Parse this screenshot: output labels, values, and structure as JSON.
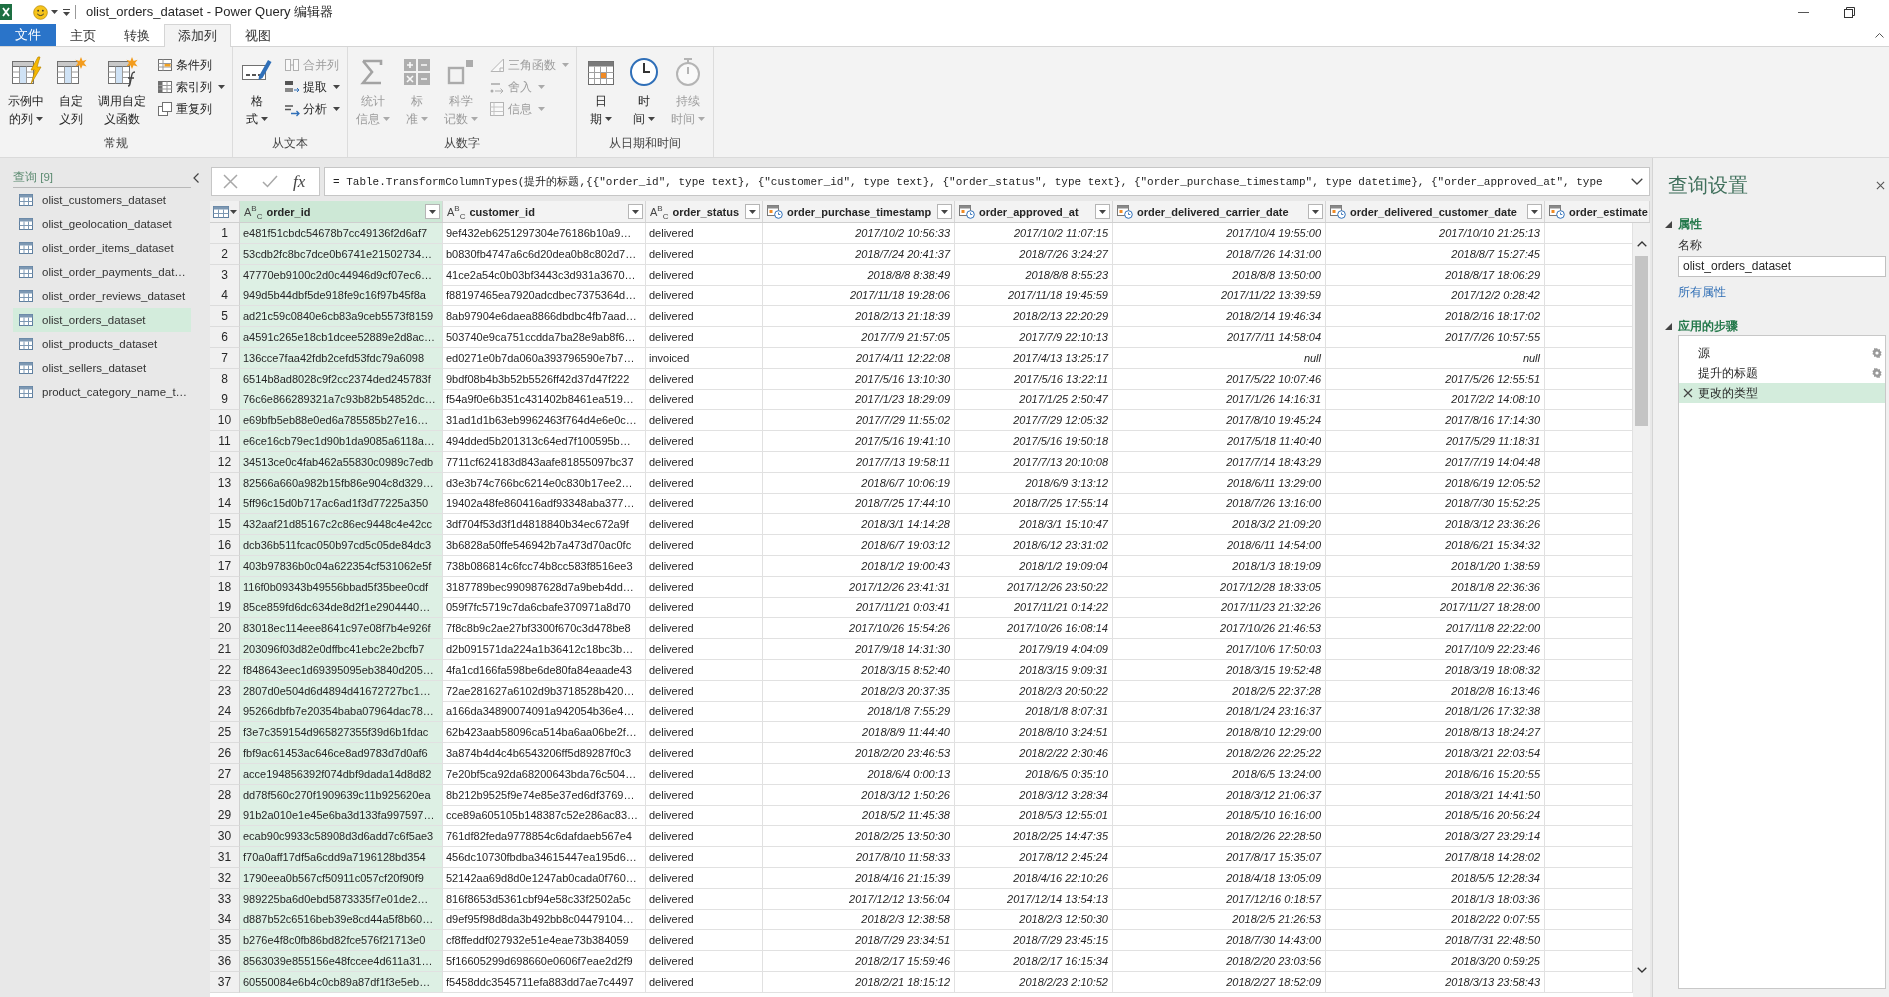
{
  "window": {
    "title": "olist_orders_dataset - Power Query 编辑器"
  },
  "menu_tabs": [
    {
      "label": "文件",
      "kind": "file",
      "selected": false
    },
    {
      "label": "主页",
      "kind": "tab",
      "selected": false
    },
    {
      "label": "转换",
      "kind": "tab",
      "selected": false
    },
    {
      "label": "添加列",
      "kind": "tab",
      "selected": true
    },
    {
      "label": "视图",
      "kind": "tab",
      "selected": false
    }
  ],
  "ribbon": {
    "groups": [
      {
        "label": "常规",
        "items": [
          {
            "kind": "large",
            "lines": [
              "示例中",
              "的列"
            ],
            "dropdown": true,
            "disabled": false
          },
          {
            "kind": "large",
            "lines": [
              "自定",
              "义列"
            ],
            "dropdown": false,
            "disabled": false
          },
          {
            "kind": "large",
            "lines": [
              "调用自定",
              "义函数"
            ],
            "dropdown": false,
            "disabled": false
          },
          {
            "kind": "small",
            "label": "条件列",
            "dropdown": false,
            "disabled": false
          },
          {
            "kind": "small",
            "label": "索引列",
            "dropdown": true,
            "disabled": false
          },
          {
            "kind": "small",
            "label": "重复列",
            "dropdown": false,
            "disabled": false
          }
        ]
      },
      {
        "label": "从文本",
        "items": [
          {
            "kind": "large",
            "lines": [
              "格",
              "式"
            ],
            "dropdown": true,
            "disabled": false
          },
          {
            "kind": "small",
            "label": "合并列",
            "dropdown": false,
            "disabled": true
          },
          {
            "kind": "small",
            "label": "提取",
            "dropdown": true,
            "disabled": false
          },
          {
            "kind": "small",
            "label": "分析",
            "dropdown": true,
            "disabled": false
          }
        ]
      },
      {
        "label": "从数字",
        "items": [
          {
            "kind": "large",
            "lines": [
              "统计",
              "信息"
            ],
            "dropdown": true,
            "disabled": true
          },
          {
            "kind": "large",
            "lines": [
              "标",
              "准"
            ],
            "dropdown": true,
            "disabled": true
          },
          {
            "kind": "large",
            "lines": [
              "科学",
              "记数"
            ],
            "dropdown": true,
            "disabled": true
          },
          {
            "kind": "small",
            "label": "三角函数",
            "dropdown": true,
            "disabled": true
          },
          {
            "kind": "small",
            "label": "舍入",
            "dropdown": true,
            "disabled": true
          },
          {
            "kind": "small",
            "label": "信息",
            "dropdown": true,
            "disabled": true
          }
        ]
      },
      {
        "label": "从日期和时间",
        "items": [
          {
            "kind": "large",
            "lines": [
              "日",
              "期"
            ],
            "dropdown": true,
            "disabled": false
          },
          {
            "kind": "large",
            "lines": [
              "时",
              "间"
            ],
            "dropdown": true,
            "disabled": false
          },
          {
            "kind": "large",
            "lines": [
              "持续",
              "时间"
            ],
            "dropdown": true,
            "disabled": true
          }
        ]
      }
    ]
  },
  "queries": {
    "title": "查询 [9]",
    "items": [
      {
        "label": "olist_customers_dataset",
        "selected": false
      },
      {
        "label": "olist_geolocation_dataset",
        "selected": false
      },
      {
        "label": "olist_order_items_dataset",
        "selected": false
      },
      {
        "label": "olist_order_payments_dat…",
        "selected": false
      },
      {
        "label": "olist_order_reviews_dataset",
        "selected": false
      },
      {
        "label": "olist_orders_dataset",
        "selected": true
      },
      {
        "label": "olist_products_dataset",
        "selected": false
      },
      {
        "label": "olist_sellers_dataset",
        "selected": false
      },
      {
        "label": "product_category_name_t…",
        "selected": false
      }
    ]
  },
  "formula_bar": {
    "function_symbol": "fx",
    "formula": "= Table.TransformColumnTypes(提升的标题,{{\"order_id\", type text}, {\"customer_id\", type text}, {\"order_status\", type text}, {\"order_purchase_timestamp\", type datetime}, {\"order_approved_at\", type"
  },
  "table": {
    "columns": [
      {
        "name": "order_id",
        "kind": "text",
        "type_symbol": "A$^{B}$$_{C}$",
        "selected": true,
        "filter_button": true
      },
      {
        "name": "customer_id",
        "kind": "text",
        "type_symbol": "A$^{B}$$_{C}$",
        "selected": false,
        "filter_button": true
      },
      {
        "name": "order_status",
        "kind": "text",
        "type_symbol": "A$^{B}$$_{C}$",
        "selected": false,
        "filter_button": true
      },
      {
        "name": "order_purchase_timestamp",
        "kind": "datetime",
        "selected": false,
        "filter_button": true
      },
      {
        "name": "order_approved_at",
        "kind": "datetime",
        "selected": false,
        "filter_button": true
      },
      {
        "name": "order_delivered_carrier_date",
        "kind": "datetime",
        "selected": false,
        "filter_button": true
      },
      {
        "name": "order_delivered_customer_date",
        "kind": "datetime",
        "selected": false,
        "filter_button": true
      },
      {
        "name": "order_estimate",
        "kind": "datetime",
        "selected": false,
        "filter_button": false
      }
    ],
    "rows": [
      {
        "number": "1",
        "cells": [
          "e481f51cbdc54678b7cc49136f2d6af7",
          "9ef432eb6251297304e76186b10a9…",
          "delivered",
          "2017/10/2 10:56:33",
          "2017/10/2 11:07:15",
          "2017/10/4 19:55:00",
          "2017/10/10 21:25:13"
        ]
      },
      {
        "number": "2",
        "cells": [
          "53cdb2fc8bc7dce0b6741e21502734…",
          "b0830fb4747a6c6d20dea0b8c802d7…",
          "delivered",
          "2018/7/24 20:41:37",
          "2018/7/26 3:24:27",
          "2018/7/26 14:31:00",
          "2018/8/7 15:27:45"
        ]
      },
      {
        "number": "3",
        "cells": [
          "47770eb9100c2d0c44946d9cf07ec6…",
          "41ce2a54c0b03bf3443c3d931a3670…",
          "delivered",
          "2018/8/8 8:38:49",
          "2018/8/8 8:55:23",
          "2018/8/8 13:50:00",
          "2018/8/17 18:06:29"
        ]
      },
      {
        "number": "4",
        "cells": [
          "949d5b44dbf5de918fe9c16f97b45f8a",
          "f88197465ea7920adcdbec7375364d…",
          "delivered",
          "2017/11/18 19:28:06",
          "2017/11/18 19:45:59",
          "2017/11/22 13:39:59",
          "2017/12/2 0:28:42"
        ]
      },
      {
        "number": "5",
        "cells": [
          "ad21c59c0840e6cb83a9ceb5573f8159",
          "8ab97904e6daea8866dbdbc4fb7aad…",
          "delivered",
          "2018/2/13 21:18:39",
          "2018/2/13 22:20:29",
          "2018/2/14 19:46:34",
          "2018/2/16 18:17:02"
        ]
      },
      {
        "number": "6",
        "cells": [
          "a4591c265e18cb1dcee52889e2d8ac…",
          "503740e9ca751ccdda7ba28e9ab8f6…",
          "delivered",
          "2017/7/9 21:57:05",
          "2017/7/9 22:10:13",
          "2017/7/11 14:58:04",
          "2017/7/26 10:57:55"
        ]
      },
      {
        "number": "7",
        "cells": [
          "136cce7faa42fdb2cefd53fdc79a6098",
          "ed0271e0b7da060a393796590e7b7…",
          "invoiced",
          "2017/4/11 12:22:08",
          "2017/4/13 13:25:17",
          "null",
          "null"
        ]
      },
      {
        "number": "8",
        "cells": [
          "6514b8ad8028c9f2cc2374ded245783f",
          "9bdf08b4b3b52b5526ff42d37d47f222",
          "delivered",
          "2017/5/16 13:10:30",
          "2017/5/16 13:22:11",
          "2017/5/22 10:07:46",
          "2017/5/26 12:55:51"
        ]
      },
      {
        "number": "9",
        "cells": [
          "76c6e866289321a7c93b82b54852dc…",
          "f54a9f0e6b351c431402b8461ea519…",
          "delivered",
          "2017/1/23 18:29:09",
          "2017/1/25 2:50:47",
          "2017/1/26 14:16:31",
          "2017/2/2 14:08:10"
        ]
      },
      {
        "number": "10",
        "cells": [
          "e69bfb5eb88e0ed6a785585b27e16…",
          "31ad1d1b63eb9962463f764d4e6e0c…",
          "delivered",
          "2017/7/29 11:55:02",
          "2017/7/29 12:05:32",
          "2017/8/10 19:45:24",
          "2017/8/16 17:14:30"
        ]
      },
      {
        "number": "11",
        "cells": [
          "e6ce16cb79ec1d90b1da9085a6118a…",
          "494dded5b201313c64ed7f100595b…",
          "delivered",
          "2017/5/16 19:41:10",
          "2017/5/16 19:50:18",
          "2017/5/18 11:40:40",
          "2017/5/29 11:18:31"
        ]
      },
      {
        "number": "12",
        "cells": [
          "34513ce0c4fab462a55830c0989c7edb",
          "7711cf624183d843aafe81855097bc37",
          "delivered",
          "2017/7/13 19:58:11",
          "2017/7/13 20:10:08",
          "2017/7/14 18:43:29",
          "2017/7/19 14:04:48"
        ]
      },
      {
        "number": "13",
        "cells": [
          "82566a660a982b15fb86e904c8d329…",
          "d3e3b74c766bc6214e0c830b17ee2…",
          "delivered",
          "2018/6/7 10:06:19",
          "2018/6/9 3:13:12",
          "2018/6/11 13:29:00",
          "2018/6/19 12:05:52"
        ]
      },
      {
        "number": "14",
        "cells": [
          "5ff96c15d0b717ac6ad1f3d77225a350",
          "19402a48fe860416adf93348aba377…",
          "delivered",
          "2018/7/25 17:44:10",
          "2018/7/25 17:55:14",
          "2018/7/26 13:16:00",
          "2018/7/30 15:52:25"
        ]
      },
      {
        "number": "15",
        "cells": [
          "432aaf21d85167c2c86ec9448c4e42cc",
          "3df704f53d3f1d4818840b34ec672a9f",
          "delivered",
          "2018/3/1 14:14:28",
          "2018/3/1 15:10:47",
          "2018/3/2 21:09:20",
          "2018/3/12 23:36:26"
        ]
      },
      {
        "number": "16",
        "cells": [
          "dcb36b511fcac050b97cd5c05de84dc3",
          "3b6828a50ffe546942b7a473d70ac0fc",
          "delivered",
          "2018/6/7 19:03:12",
          "2018/6/12 23:31:02",
          "2018/6/11 14:54:00",
          "2018/6/21 15:34:32"
        ]
      },
      {
        "number": "17",
        "cells": [
          "403b97836b0c04a622354cf531062e5f",
          "738b086814c6fcc74b8cc583f8516ee3",
          "delivered",
          "2018/1/2 19:00:43",
          "2018/1/2 19:09:04",
          "2018/1/3 18:19:09",
          "2018/1/20 1:38:59"
        ]
      },
      {
        "number": "18",
        "cells": [
          "116f0b09343b49556bbad5f35bee0cdf",
          "3187789bec990987628d7a9beb4dd…",
          "delivered",
          "2017/12/26 23:41:31",
          "2017/12/26 23:50:22",
          "2017/12/28 18:33:05",
          "2018/1/8 22:36:36"
        ]
      },
      {
        "number": "19",
        "cells": [
          "85ce859fd6dc634de8d2f1e2904440…",
          "059f7fc5719c7da6cbafe370971a8d70",
          "delivered",
          "2017/11/21 0:03:41",
          "2017/11/21 0:14:22",
          "2017/11/23 21:32:26",
          "2017/11/27 18:28:00"
        ]
      },
      {
        "number": "20",
        "cells": [
          "83018ec114eee8641c97e08f7b4e926f",
          "7f8c8b9c2ae27bf3300f670c3d478be8",
          "delivered",
          "2017/10/26 15:54:26",
          "2017/10/26 16:08:14",
          "2017/10/26 21:46:53",
          "2017/11/8 22:22:00"
        ]
      },
      {
        "number": "21",
        "cells": [
          "203096f03d82e0dffbc41ebc2e2bcfb7",
          "d2b091571da224a1b36412c18bc3b…",
          "delivered",
          "2017/9/18 14:31:30",
          "2017/9/19 4:04:09",
          "2017/10/6 17:50:03",
          "2017/10/9 22:23:46"
        ]
      },
      {
        "number": "22",
        "cells": [
          "f848643eec1d69395095eb3840d205…",
          "4fa1cd166fa598be6de80fa84eaade43",
          "delivered",
          "2018/3/15 8:52:40",
          "2018/3/15 9:09:31",
          "2018/3/15 19:52:48",
          "2018/3/19 18:08:32"
        ]
      },
      {
        "number": "23",
        "cells": [
          "2807d0e504d6d4894d41672727bc1…",
          "72ae281627a6102d9b3718528b420…",
          "delivered",
          "2018/2/3 20:37:35",
          "2018/2/3 20:50:22",
          "2018/2/5 22:37:28",
          "2018/2/8 16:13:46"
        ]
      },
      {
        "number": "24",
        "cells": [
          "95266dbfb7e20354baba07964dac78…",
          "a166da34890074091a942054b36e4…",
          "delivered",
          "2018/1/8 7:55:29",
          "2018/1/8 8:07:31",
          "2018/1/24 23:16:37",
          "2018/1/26 17:32:38"
        ]
      },
      {
        "number": "25",
        "cells": [
          "f3e7c359154d965827355f39d6b1fdac",
          "62b423aab58096ca514ba6aa06be2f…",
          "delivered",
          "2018/8/9 11:44:40",
          "2018/8/10 3:24:51",
          "2018/8/10 12:29:00",
          "2018/8/13 18:24:27"
        ]
      },
      {
        "number": "26",
        "cells": [
          "fbf9ac61453ac646ce8ad9783d7d0af6",
          "3a874b4d4c4b6543206ff5d89287f0c3",
          "delivered",
          "2018/2/20 23:46:53",
          "2018/2/22 2:30:46",
          "2018/2/26 22:25:22",
          "2018/3/21 22:03:54"
        ]
      },
      {
        "number": "27",
        "cells": [
          "acce194856392f074dbf9dada14d8d82",
          "7e20bf5ca92da68200643bda76c504…",
          "delivered",
          "2018/6/4 0:00:13",
          "2018/6/5 0:35:10",
          "2018/6/5 13:24:00",
          "2018/6/16 15:20:55"
        ]
      },
      {
        "number": "28",
        "cells": [
          "dd78f560c270f1909639c11b925620ea",
          "8b212b9525f9e74e85e37ed6df3769…",
          "delivered",
          "2018/3/12 1:50:26",
          "2018/3/12 3:28:34",
          "2018/3/12 21:06:37",
          "2018/3/21 14:41:50"
        ]
      },
      {
        "number": "29",
        "cells": [
          "91b2a010e1e45e6ba3d133fa997597…",
          "cce89a605105b148387c52e286ac83…",
          "delivered",
          "2018/5/2 11:45:38",
          "2018/5/3 12:55:01",
          "2018/5/10 16:16:00",
          "2018/5/16 20:56:24"
        ]
      },
      {
        "number": "30",
        "cells": [
          "ecab90c9933c58908d3d6add7c6f5ae3",
          "761df82feda9778854c6dafdaeb567e4",
          "delivered",
          "2018/2/25 13:50:30",
          "2018/2/25 14:47:35",
          "2018/2/26 22:28:50",
          "2018/3/27 23:29:14"
        ]
      },
      {
        "number": "31",
        "cells": [
          "f70a0aff17df5a6cdd9a7196128bd354",
          "456dc10730fbdba34615447ea195d6…",
          "delivered",
          "2017/8/10 11:58:33",
          "2017/8/12 2:45:24",
          "2017/8/17 15:35:07",
          "2017/8/18 14:28:02"
        ]
      },
      {
        "number": "32",
        "cells": [
          "1790eea0b567cf50911c057cf20f90f9",
          "52142aa69d8d0e1247ab0cada0f760…",
          "delivered",
          "2018/4/16 21:15:39",
          "2018/4/16 22:10:26",
          "2018/4/18 13:05:09",
          "2018/5/5 12:28:34"
        ]
      },
      {
        "number": "33",
        "cells": [
          "989225ba6d0ebd5873335f7e01de2…",
          "816f8653d5361cbf94e58c33f2502a5c",
          "delivered",
          "2017/12/12 13:56:04",
          "2017/12/14 13:54:13",
          "2017/12/16 0:18:57",
          "2018/1/3 18:03:36"
        ]
      },
      {
        "number": "34",
        "cells": [
          "d887b52c6516beb39e8cd44a5f8b60…",
          "d9ef95f98d8da3b492bb8c04479104…",
          "delivered",
          "2018/2/3 12:38:58",
          "2018/2/3 12:50:30",
          "2018/2/5 21:26:53",
          "2018/2/22 0:07:55"
        ]
      },
      {
        "number": "35",
        "cells": [
          "b276e4f8c0fb86bd82fce576f21713e0",
          "cf8ffeddf027932e51e4eae73b384059",
          "delivered",
          "2018/7/29 23:34:51",
          "2018/7/29 23:45:15",
          "2018/7/30 14:43:00",
          "2018/7/31 22:48:50"
        ]
      },
      {
        "number": "36",
        "cells": [
          "8563039e855156e48fccee4d611a31…",
          "5f16605299d698660e0606f7eae2d2f9",
          "delivered",
          "2018/2/17 15:59:46",
          "2018/2/17 16:15:34",
          "2018/2/20 23:03:56",
          "2018/3/20 0:59:25"
        ]
      },
      {
        "number": "37",
        "cells": [
          "60550084e6b4c0cb89a87df1f3e5eb…",
          "f5458ddc3545711efa883dd7ae7c4497",
          "delivered",
          "2018/2/21 18:15:12",
          "2018/2/23 2:10:52",
          "2018/2/27 18:52:09",
          "2018/3/13 23:58:43"
        ]
      }
    ]
  },
  "query_settings": {
    "title": "查询设置",
    "properties": {
      "heading": "属性",
      "expanded": true,
      "name_label": "名称",
      "name_value": "olist_orders_dataset",
      "link": "所有属性"
    },
    "applied_steps": {
      "heading": "应用的步骤",
      "expanded": true,
      "steps": [
        {
          "label": "源",
          "selected": false,
          "has_settings": true
        },
        {
          "label": "提升的标题",
          "selected": false,
          "has_settings": true
        },
        {
          "label": "更改的类型",
          "selected": true,
          "has_settings": false
        }
      ]
    }
  }
}
